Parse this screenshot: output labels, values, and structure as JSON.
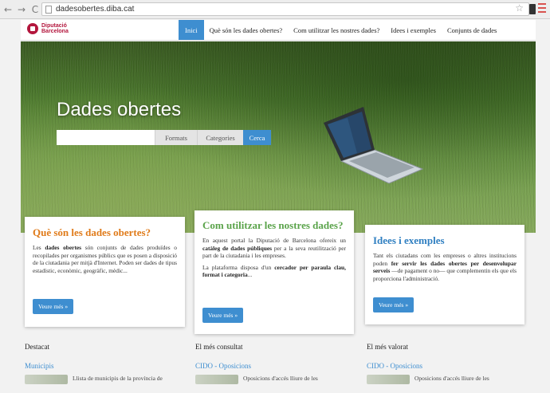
{
  "browser": {
    "url": "dadesobertes.diba.cat",
    "back_glyph": "←",
    "forward_glyph": "→",
    "reload_glyph": "C",
    "star_glyph": "☆"
  },
  "header": {
    "logo_line1": "Diputació",
    "logo_line2": "Barcelona",
    "nav": [
      {
        "label": "Inici"
      },
      {
        "label": "Què són les dades obertes?"
      },
      {
        "label": "Com utilitzar les nostres dades?"
      },
      {
        "label": "Idees i exemples"
      },
      {
        "label": "Conjunts de dades"
      }
    ]
  },
  "hero": {
    "title": "Dades obertes",
    "search_placeholder": "",
    "tab_formats": "Formats",
    "tab_categories": "Categories",
    "search_button": "Cerca"
  },
  "cards": [
    {
      "title": "Què són les dades obertes?",
      "text_a": "Les ",
      "text_b": "dades obertes",
      "text_c": " són conjunts de dades produïdes o recopilades per organismes públics que es posen a disposició de la ciutadania per mitjà d'Internet. Poden ser dades de tipus estadístic, econòmic, geogràfic, mèdic...",
      "button": "Veure més »"
    },
    {
      "title": "Com utilitzar les nostres dades?",
      "p1_a": "En aquest portal la Diputació de Barcelona ofereix un ",
      "p1_b": "catàleg de dades públiques",
      "p1_c": " per a la seva reutilització per part de la ciutadania i les empreses.",
      "p2_a": "La plataforma disposa d'un ",
      "p2_b": "cercador per paraula clau, format i categoria",
      "p2_c": "...",
      "button": "Veure més »"
    },
    {
      "title": "Idees i exemples",
      "text_a": "Tant els ciutadans com les empreses o altres institucions poden ",
      "text_b": "fer servir les dades obertes per desenvolupar serveis",
      "text_c": " —de pagament o no— que complementin els que els proporciona l'administració.",
      "button": "Veure més »"
    }
  ],
  "lower": [
    {
      "heading": "Destacat",
      "link": "Municipis",
      "desc": "Llista de municipis de la província de"
    },
    {
      "heading": "El més consultat",
      "link": "CIDO - Oposicions",
      "desc": "Oposicions d'accés lliure de les"
    },
    {
      "heading": "El més valorat",
      "link": "CIDO - Oposicions",
      "desc": "Oposicions d'accés lliure de les"
    }
  ]
}
